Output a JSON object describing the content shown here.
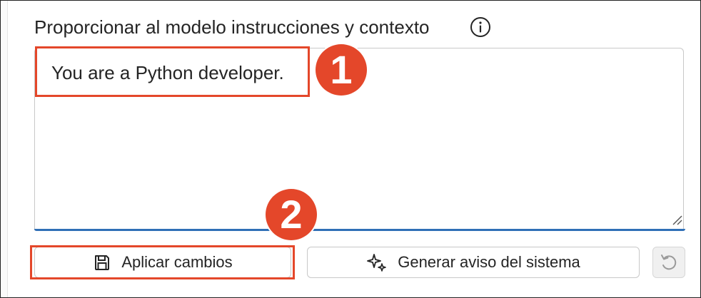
{
  "section": {
    "label": "Proporcionar al modelo instrucciones y contexto",
    "info_icon": "info-circle-icon"
  },
  "system_message": {
    "value": "You are a Python developer."
  },
  "markers": {
    "one": "1",
    "two": "2"
  },
  "buttons": {
    "apply_label": "Aplicar cambios",
    "apply_icon": "save-icon",
    "generate_label": "Generar aviso del sistema",
    "generate_icon": "sparkle-icon",
    "reset_icon": "undo-icon",
    "reset_enabled": false
  },
  "colors": {
    "annotation": "#e4472a",
    "focus_underline": "#2f6fb6"
  }
}
